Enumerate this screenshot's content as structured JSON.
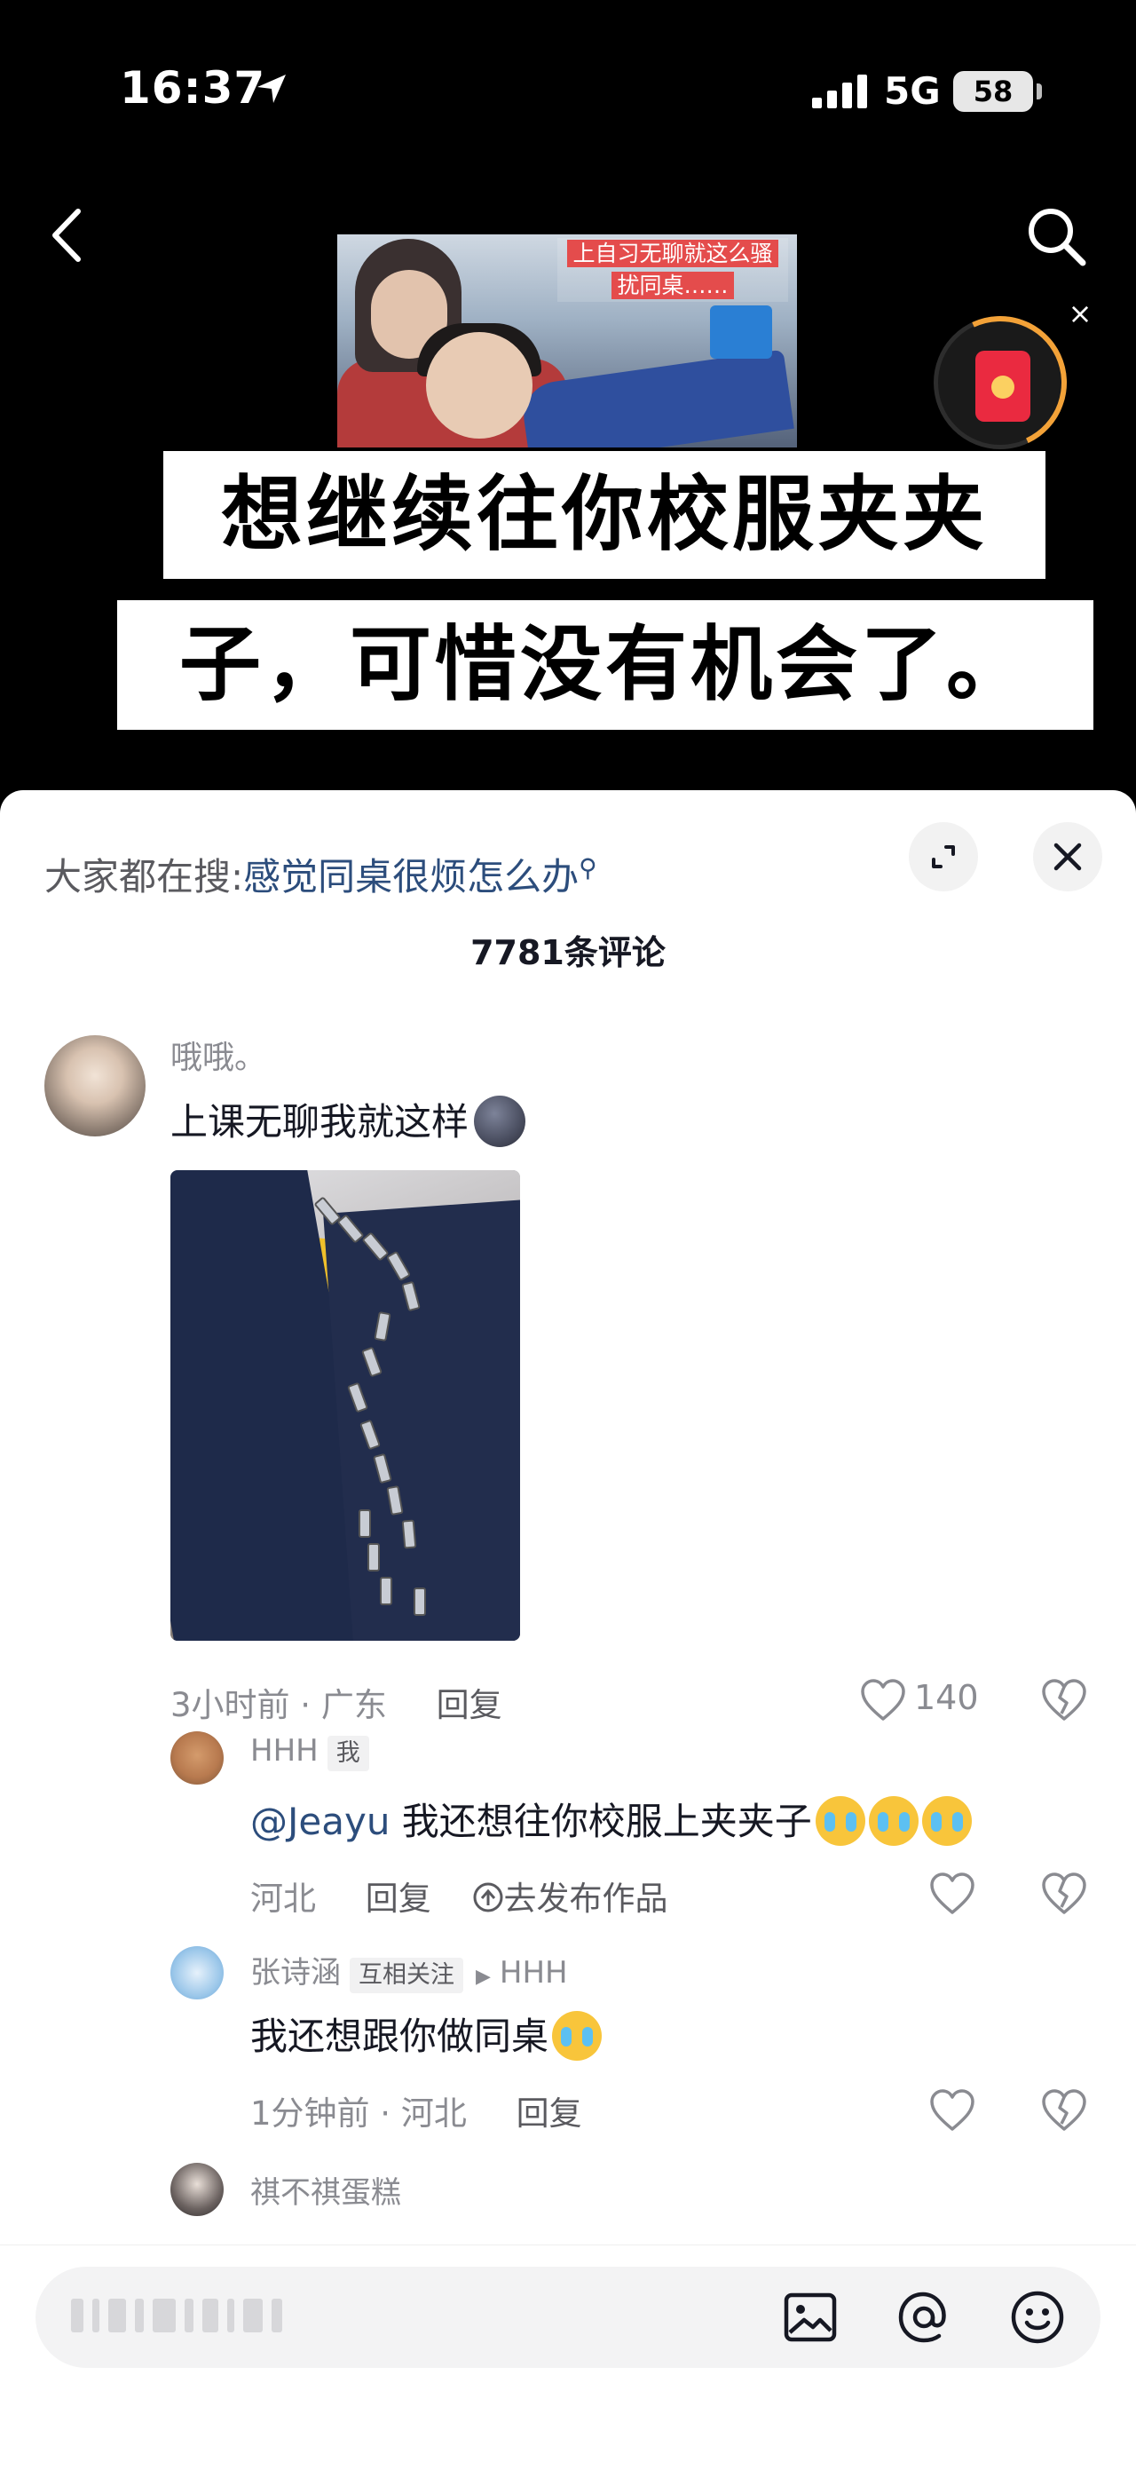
{
  "status_bar": {
    "time": "16:37",
    "network": "5G",
    "battery": "58"
  },
  "video": {
    "thumbnail_caption_line1": "上自习无聊就这么骚",
    "thumbnail_caption_line2": "扰同桌……",
    "subtitle_line1": "想继续往你校服夹夹",
    "subtitle_line2": "子，可惜没有机会了。",
    "redpacket_close": "×"
  },
  "comments_sheet": {
    "search_prefix": "大家都在搜:",
    "search_keyword": "感觉同桌很烦怎么办",
    "search_glyph": "⚲",
    "count_label": "7781条评论",
    "comments": [
      {
        "user": "哦哦。",
        "text": "上课无聊我就这样",
        "time_location": "3小时前 · 广东",
        "reply_label": "回复",
        "likes": "140"
      }
    ],
    "replies": [
      {
        "user": "HHH",
        "badge": "我",
        "mention": "@Jeayu",
        "text": " 我还想往你校服上夹夹子",
        "location": "河北",
        "reply_label": "回复",
        "publish_label": "去发布作品"
      },
      {
        "user": "张诗涵",
        "badge": "互相关注",
        "reply_to": "HHH",
        "text": "我还想跟你做同桌",
        "time_location": "1分钟前 · 河北",
        "reply_label": "回复"
      },
      {
        "user": "祺不祺蛋糕"
      }
    ]
  },
  "icons": {
    "back": "back-arrow-icon",
    "search": "search-icon",
    "expand": "expand-icon",
    "close": "close-icon",
    "like": "heart-icon",
    "dislike": "broken-heart-icon",
    "image": "image-icon",
    "mention": "at-icon",
    "emoji": "smiley-icon"
  },
  "colors": {
    "link_blue": "#2c4d7c",
    "muted_text": "#8a8b91",
    "primary_text": "#161823",
    "redpacket": "#ea2a40"
  }
}
